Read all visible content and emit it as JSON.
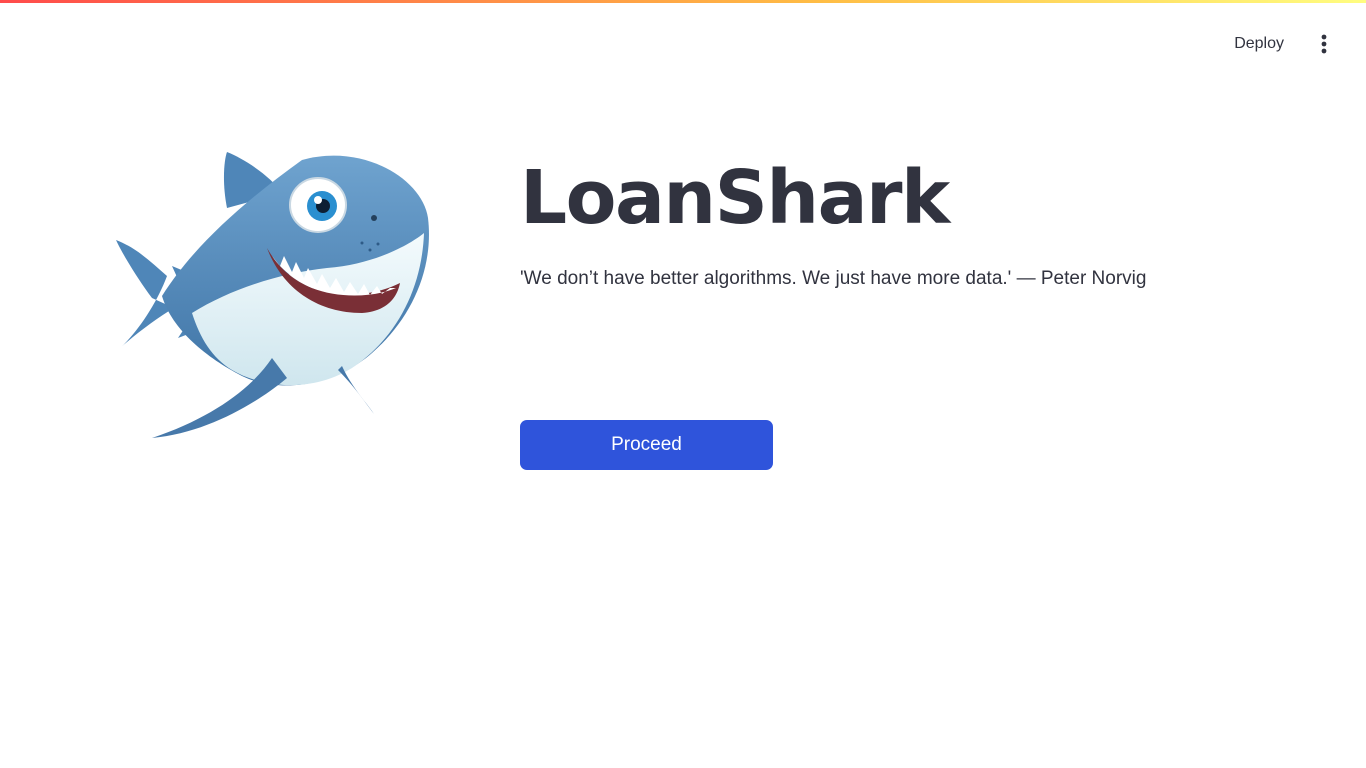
{
  "header": {
    "deploy_label": "Deploy",
    "menu_icon": "vertical-ellipsis-icon",
    "accent_gradient": [
      "#ff4b4b",
      "#ffbd45",
      "#fffd80"
    ]
  },
  "hero": {
    "mascot_icon": "cartoon-shark-icon",
    "title": "LoanShark",
    "quote": "'We don’t have better algorithms. We just have more data.' — Peter Norvig",
    "proceed_label": "Proceed",
    "button_color": "#2f54db"
  }
}
